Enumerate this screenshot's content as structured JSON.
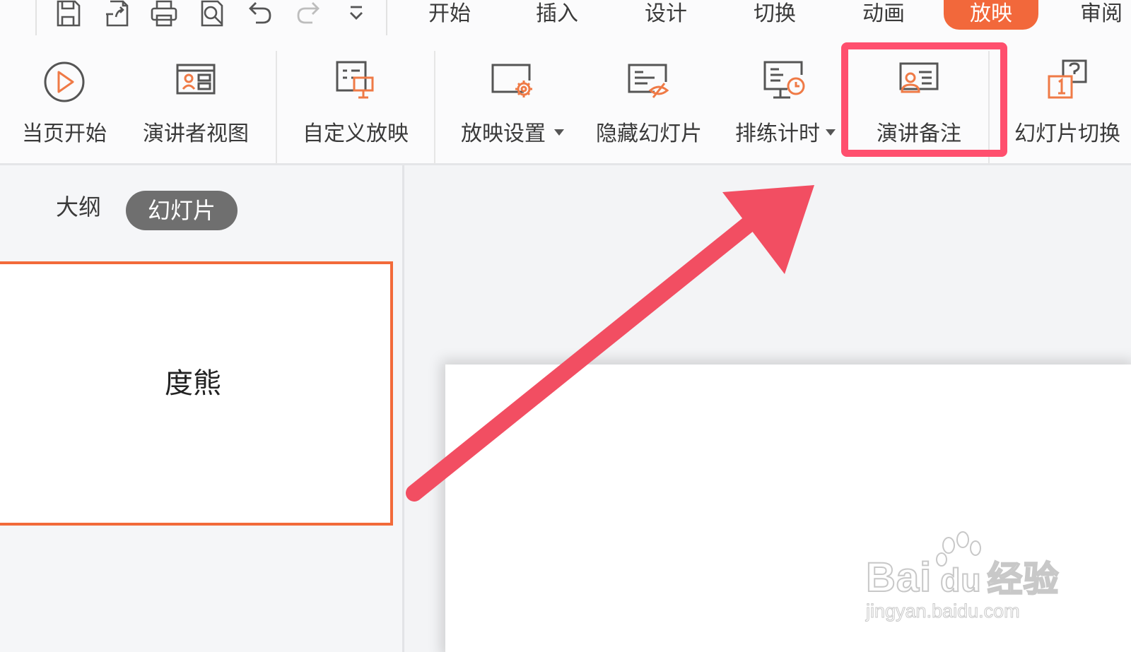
{
  "quick_access": {
    "icons": [
      "save-icon",
      "export-icon",
      "print-icon",
      "print-preview-icon",
      "undo-icon",
      "redo-icon",
      "customize-dropdown-icon"
    ]
  },
  "tabs": {
    "start": "开始",
    "insert": "插入",
    "design": "设计",
    "transition": "切换",
    "animation": "动画",
    "slideshow": "放映",
    "review": "审阅"
  },
  "active_tab": "放映",
  "ribbon": {
    "from_current": "当页开始",
    "presenter_view": "演讲者视图",
    "custom_show": "自定义放映",
    "show_settings": "放映设置",
    "hide_slide": "隐藏幻灯片",
    "rehearse_timing": "排练计时",
    "speaker_notes": "演讲备注",
    "slide_transition": "幻灯片切换"
  },
  "panel": {
    "tab_outline": "大纲",
    "tab_slides": "幻灯片",
    "thumbnail_text": "度熊"
  },
  "watermark": {
    "brand": "Bai",
    "brand_suffix": "du",
    "brand_cn": "经验",
    "url": "jingyan.baidu.com"
  },
  "colors": {
    "accent": "#f2683b",
    "highlight": "#ff4f6e",
    "icon_orange": "#ef7a46",
    "icon_gray": "#555555"
  }
}
